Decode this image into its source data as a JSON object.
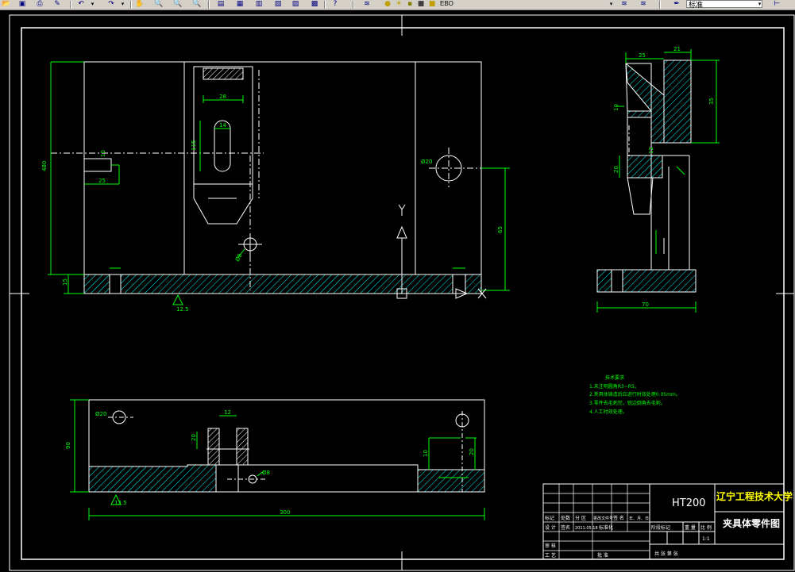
{
  "toolbar": {
    "icons": [
      "open-icon",
      "save-icon",
      "print-icon",
      "undo-icon",
      "redo-icon",
      "pan-icon",
      "zoom-realtime-icon",
      "zoom-window-icon",
      "zoom-previous-icon",
      "properties-icon",
      "design-center-icon",
      "tool-palette-icon",
      "sheet-set-icon",
      "markup-icon",
      "calculator-icon",
      "help-icon",
      "layer-manager-icon",
      "layer-state-icon"
    ],
    "layer_combo_value": "EBO",
    "style_combo_value": "标准"
  },
  "drawing": {
    "colors": {
      "background": "#000000",
      "outline": "#ffffff",
      "dimension": "#00ff00",
      "hatch": "#00ffff",
      "text_yellow": "#ffff00"
    },
    "tech_notes": {
      "title": "技术要求",
      "lines": [
        "1.未注明圆角R3~R5。",
        "2.夹具体铸造后应进行时效处理0.05mm。",
        "3.零件去毛刺完，锐边倒角去毛刺。",
        "4.人工时效处理。"
      ]
    },
    "title_block": {
      "material": "HT200",
      "school": "辽宁工程技术大学",
      "drawing_name": "夹具体零件图",
      "scale": "1:1",
      "row_labels": [
        "标记",
        "处数",
        "分 区",
        "更改文件号",
        "签 名",
        "年、月、日"
      ],
      "row_labels2": [
        "设 计",
        "签名",
        "2011.05.18",
        "标准化"
      ],
      "stage_labels": [
        "阶段标记",
        "重 量",
        "比 例"
      ],
      "bottom_labels": [
        "审 核",
        "工 艺",
        "批 准"
      ],
      "sheet_labels": "共  张  第  张"
    },
    "dims": {
      "front_height": "480",
      "front_base": "15",
      "slot_width": "28",
      "slot_height": "115",
      "slot_inner": "14",
      "left_notch": "25",
      "left_notch_r": "10",
      "hole_dia": "Ø20",
      "hole_height": "65",
      "small_hole": "Ø8",
      "roughness_front": "12.5",
      "side_top_a": "25",
      "side_top_b": "21",
      "side_h": "35",
      "side_small": "10",
      "side_small2": "12",
      "side_small3": "20",
      "side_base": "70",
      "top_view_height": "90",
      "top_view_width": "300",
      "top_view_slot": "12",
      "top_view_hole": "Ø20",
      "top_view_r": "20",
      "top_view_d1": "10",
      "top_view_d2": "20",
      "top_view_d3": "Ø8",
      "roughness_top": "12.5",
      "ucs_y": "Y",
      "ucs_x": "X"
    }
  }
}
